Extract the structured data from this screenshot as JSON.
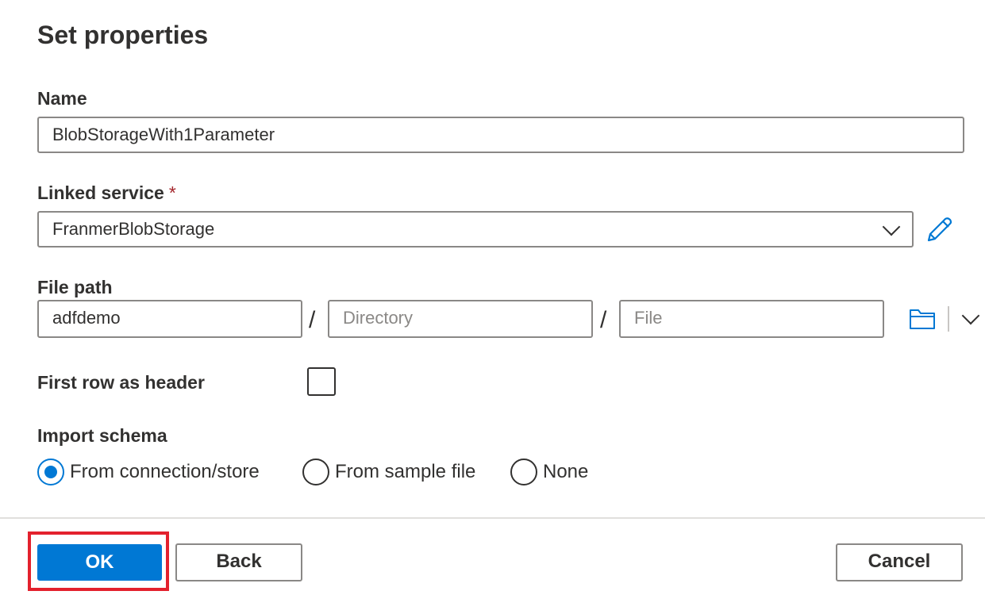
{
  "dialog": {
    "title": "Set properties"
  },
  "name": {
    "label": "Name",
    "value": "BlobStorageWith1Parameter"
  },
  "linked_service": {
    "label": "Linked service",
    "required_mark": "*",
    "value": "FranmerBlobStorage",
    "edit_icon": "pencil-icon"
  },
  "file_path": {
    "label": "File path",
    "container_value": "adfdemo",
    "separator": "/",
    "directory_placeholder": "Directory",
    "file_placeholder": "File",
    "browse_icon": "folder-icon"
  },
  "first_row_header": {
    "label": "First row as header",
    "checked": false
  },
  "import_schema": {
    "label": "Import schema",
    "options": [
      {
        "label": "From connection/store",
        "selected": true
      },
      {
        "label": "From sample file",
        "selected": false
      },
      {
        "label": "None",
        "selected": false
      }
    ]
  },
  "footer": {
    "ok_label": "OK",
    "back_label": "Back",
    "cancel_label": "Cancel"
  },
  "colors": {
    "accent": "#0078d4",
    "highlight": "#e3212d",
    "required": "#a4262c"
  }
}
